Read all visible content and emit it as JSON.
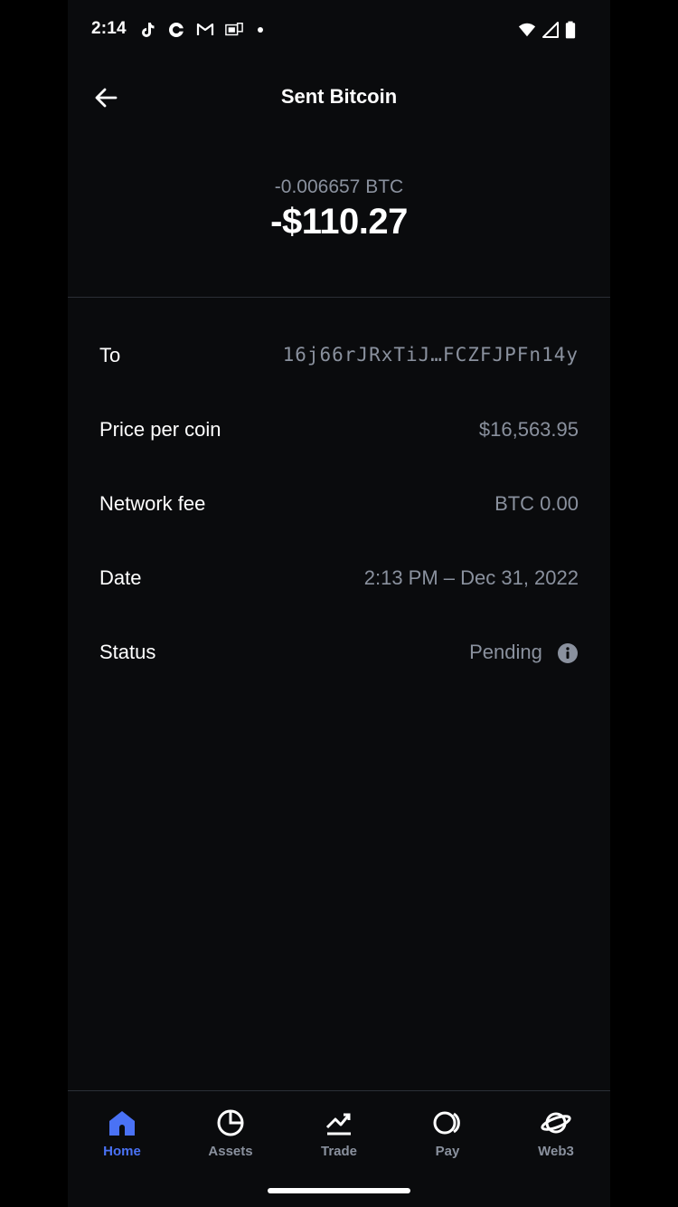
{
  "status_bar": {
    "time": "2:14",
    "left_icons": [
      "tiktok-icon",
      "coinbase-icon",
      "gmail-icon",
      "news-icon",
      "notification-dot"
    ],
    "right_icons": [
      "wifi-icon",
      "signal-icon",
      "battery-icon"
    ]
  },
  "header": {
    "title": "Sent Bitcoin",
    "back_icon": "arrow-left-icon"
  },
  "amount": {
    "crypto": "-0.006657 BTC",
    "fiat": "-$110.27"
  },
  "details": {
    "to_label": "To",
    "to_value": "16j66rJRxTiJ…FCZFJPFn14y",
    "price_label": "Price per coin",
    "price_value": "$16,563.95",
    "fee_label": "Network fee",
    "fee_value": "BTC 0.00",
    "date_label": "Date",
    "date_value": "2:13 PM – Dec 31, 2022",
    "status_label": "Status",
    "status_value": "Pending",
    "status_icon": "info-icon"
  },
  "nav": {
    "active": "Home",
    "items": [
      {
        "label": "Home",
        "icon": "home-icon"
      },
      {
        "label": "Assets",
        "icon": "pie-chart-icon"
      },
      {
        "label": "Trade",
        "icon": "trend-chart-icon"
      },
      {
        "label": "Pay",
        "icon": "pay-icon"
      },
      {
        "label": "Web3",
        "icon": "planet-icon"
      }
    ]
  },
  "colors": {
    "background": "#0a0b0d",
    "accent": "#4a72f5",
    "muted": "#8a919e",
    "divider": "#2b2f36"
  }
}
